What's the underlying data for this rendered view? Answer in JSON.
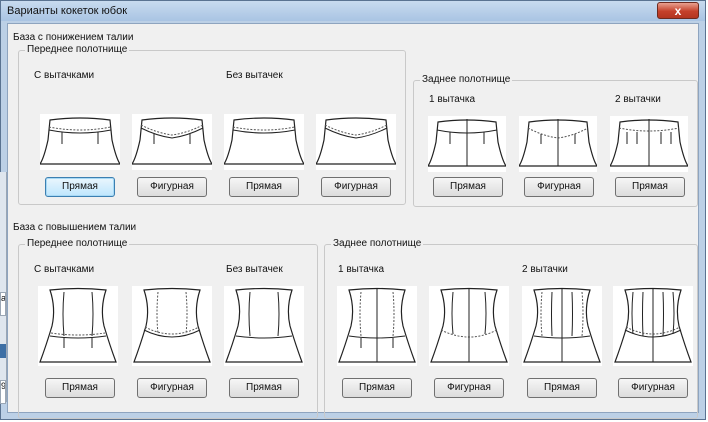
{
  "window": {
    "title": "Варианты кокеток юбок",
    "close_glyph": "x"
  },
  "lowered": {
    "title": "База с понижением талии",
    "front": {
      "title": "Переднее полотнище",
      "with_darts": "С вытачками",
      "no_darts": "Без вытачек",
      "buttons": [
        "Прямая",
        "Фигурная",
        "Прямая",
        "Фигурная"
      ]
    },
    "back": {
      "title": "Заднее полотнище",
      "one_dart": "1 вытачка",
      "two_darts": "2 вытачки",
      "buttons": [
        "Прямая",
        "Фигурная",
        "Прямая"
      ]
    }
  },
  "raised": {
    "title": "База с повышением талии",
    "front": {
      "title": "Переднее полотнище",
      "with_darts": "С вытачками",
      "no_darts": "Без вытачек",
      "buttons": [
        "Прямая",
        "Фигурная",
        "Прямая"
      ]
    },
    "back": {
      "title": "Заднее полотнище",
      "one_dart": "1 вытачка",
      "two_darts": "2 вытачки",
      "buttons": [
        "Прямая",
        "Фигурная",
        "Прямая",
        "Фигурная"
      ]
    }
  },
  "background_fragments": {
    "left_text": "ач",
    "left_text2": "92"
  },
  "colors": {
    "accent": "#3c7fb1",
    "titlebar": "#a9c4e3",
    "close": "#c5412b"
  }
}
